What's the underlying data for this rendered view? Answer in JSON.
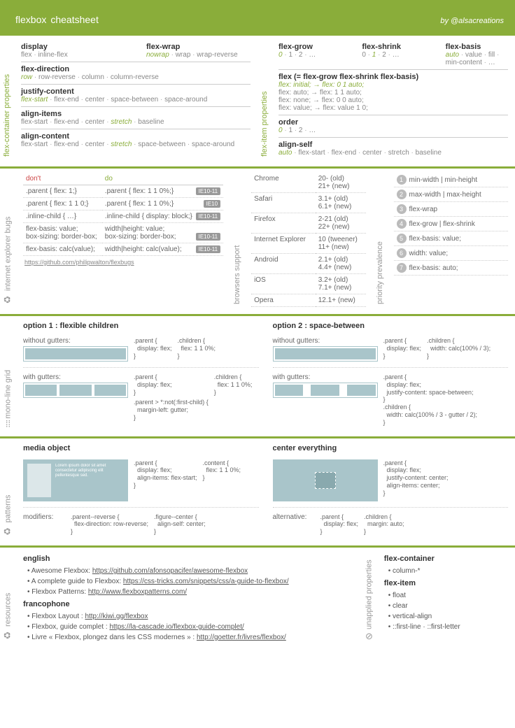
{
  "header": {
    "title": "flexbox",
    "subtitle": "cheatsheet",
    "credit": "by @alsacreations"
  },
  "container_props": [
    {
      "row": [
        {
          "name": "display",
          "vals": [
            [
              "",
              "flex"
            ],
            [
              "sep",
              " · "
            ],
            [
              "",
              "inline-flex"
            ]
          ]
        },
        {
          "name": "flex-wrap",
          "vals": [
            [
              "def",
              "nowrap"
            ],
            [
              "sep",
              " · "
            ],
            [
              "",
              "wrap"
            ],
            [
              "sep",
              " · "
            ],
            [
              "",
              "wrap-reverse"
            ]
          ]
        }
      ]
    },
    {
      "name": "flex-direction",
      "vals": [
        [
          "def",
          "row"
        ],
        [
          "sep",
          " · "
        ],
        [
          "",
          "row-reverse"
        ],
        [
          "sep",
          " · "
        ],
        [
          "",
          "column"
        ],
        [
          "sep",
          " · "
        ],
        [
          "",
          "column-reverse"
        ]
      ]
    },
    {
      "name": "justify-content",
      "vals": [
        [
          "def",
          "flex-start"
        ],
        [
          "sep",
          " · "
        ],
        [
          "",
          "flex-end"
        ],
        [
          "sep",
          " · "
        ],
        [
          "",
          "center"
        ],
        [
          "sep",
          " · "
        ],
        [
          "",
          "space-between"
        ],
        [
          "sep",
          " · "
        ],
        [
          "",
          "space-around"
        ]
      ]
    },
    {
      "name": "align-items",
      "vals": [
        [
          "",
          "flex-start"
        ],
        [
          "sep",
          " · "
        ],
        [
          "",
          "flex-end"
        ],
        [
          "sep",
          " · "
        ],
        [
          "",
          "center"
        ],
        [
          "sep",
          " · "
        ],
        [
          "def",
          "stretch"
        ],
        [
          "sep",
          " · "
        ],
        [
          "",
          "baseline"
        ]
      ]
    },
    {
      "name": "align-content",
      "vals": [
        [
          "",
          "flex-start"
        ],
        [
          "sep",
          " · "
        ],
        [
          "",
          "flex-end"
        ],
        [
          "sep",
          " · "
        ],
        [
          "",
          "center"
        ],
        [
          "sep",
          " · "
        ],
        [
          "def",
          "stretch"
        ],
        [
          "sep",
          " · "
        ],
        [
          "",
          "space-between"
        ],
        [
          "sep",
          " · "
        ],
        [
          "",
          "space-around"
        ]
      ]
    }
  ],
  "item_props": [
    {
      "row": [
        {
          "name": "flex-grow",
          "vals": [
            [
              "def",
              "0"
            ],
            [
              "sep",
              " · "
            ],
            [
              "",
              "1"
            ],
            [
              "sep",
              " · "
            ],
            [
              "",
              "2"
            ],
            [
              "sep",
              " · "
            ],
            [
              "",
              "…"
            ]
          ]
        },
        {
          "name": "flex-shrink",
          "vals": [
            [
              "",
              "0"
            ],
            [
              "sep",
              " · "
            ],
            [
              "def",
              "1"
            ],
            [
              "sep",
              " · "
            ],
            [
              "",
              "2"
            ],
            [
              "sep",
              " · "
            ],
            [
              "",
              "…"
            ]
          ]
        },
        {
          "name": "flex-basis",
          "vals": [
            [
              "def",
              "auto"
            ],
            [
              "sep",
              " · "
            ],
            [
              "",
              "value"
            ],
            [
              "sep",
              " · "
            ],
            [
              "",
              "fill"
            ],
            [
              "sep",
              " · "
            ],
            [
              "",
              "min-content"
            ],
            [
              "sep",
              " · "
            ],
            [
              "",
              "…"
            ]
          ]
        }
      ]
    },
    {
      "name": "flex (= flex-grow flex-shrink flex-basis)",
      "lines": [
        "flex: initial; → flex: 0 1 auto;",
        "flex: auto; → flex: 1 1 auto;",
        "flex: none; → flex: 0 0 auto;",
        "flex: value; → flex: value 1 0;"
      ],
      "firstdef": true
    },
    {
      "name": "order",
      "vals": [
        [
          "def",
          "0"
        ],
        [
          "sep",
          " · "
        ],
        [
          "",
          "1"
        ],
        [
          "sep",
          " · "
        ],
        [
          "",
          "2"
        ],
        [
          "sep",
          " · "
        ],
        [
          "",
          "…"
        ]
      ]
    },
    {
      "name": "align-self",
      "vals": [
        [
          "def",
          "auto"
        ],
        [
          "sep",
          " · "
        ],
        [
          "",
          "flex-start"
        ],
        [
          "sep",
          " · "
        ],
        [
          "",
          "flex-end"
        ],
        [
          "sep",
          " · "
        ],
        [
          "",
          "center"
        ],
        [
          "sep",
          " · "
        ],
        [
          "",
          "stretch"
        ],
        [
          "sep",
          " · "
        ],
        [
          "",
          "baseline"
        ]
      ]
    }
  ],
  "bugs": {
    "headers": [
      "don't",
      "do",
      ""
    ],
    "rows": [
      [
        ".parent { flex: 1;}",
        ".parent { flex: 1 1 0%;}",
        "IE10-11"
      ],
      [
        ".parent { flex: 1 1 0;}",
        ".parent { flex: 1 1 0%;}",
        "IE10"
      ],
      [
        ".inline-child { …}",
        ".inline-child { display: block;}",
        "IE10-11"
      ],
      [
        "flex-basis: value;\nbox-sizing: border-box;",
        "width|height: value;\nbox-sizing: border-box;",
        "IE10-11"
      ],
      [
        "flex-basis:  calc(value);",
        "width|height:  calc(value);",
        "IE10-11"
      ]
    ],
    "link": "https://github.com/philipwalton/flexbugs"
  },
  "browsers": {
    "rows": [
      [
        "Chrome",
        "20- (old)\n21+ (new)"
      ],
      [
        "Safari",
        "3.1+ (old)\n6.1+ (new)"
      ],
      [
        "Firefox",
        "2-21 (old)\n22+ (new)"
      ],
      [
        "Internet Explorer",
        "10 (tweener)\n11+ (new)"
      ],
      [
        "Android",
        "2.1+ (old)\n4.4+ (new)"
      ],
      [
        "iOS",
        "3.2+ (old)\n7.1+ (new)"
      ],
      [
        "Opera",
        "12.1+ (new)"
      ]
    ]
  },
  "priority": [
    "min-width | min-height",
    "max-width | max-height",
    "flex-wrap",
    "flex-grow | flex-shrink",
    "flex-basis: value;",
    "width: value;",
    "flex-basis: auto;"
  ],
  "grid": {
    "opt1": {
      "title": "option 1 : flexible children",
      "without_label": "without gutters:",
      "without_code": [
        ".parent {\n  display: flex;\n}",
        ".children {\n  flex: 1 1 0%;\n}"
      ],
      "with_label": "with gutters:",
      "with_code": [
        ".parent {\n  display: flex;\n}",
        ".children {\n  flex: 1 1 0%;\n}",
        ".parent > *:not(:first-child) {\n  margin-left: gutter;\n}"
      ]
    },
    "opt2": {
      "title": "option 2 : space-between",
      "without_label": "without gutters:",
      "without_code": [
        ".parent {\n  display: flex;\n}",
        ".children {\n  width: calc(100% / 3);\n}"
      ],
      "with_label": "with gutters:",
      "with_code": [
        ".parent {\n  display: flex;\n  justify-content: space-between;\n}\n.children {\n  width: calc(100% / 3 - gutter / 2);\n}"
      ]
    }
  },
  "patterns": {
    "media": {
      "title": "media object",
      "code": [
        ".parent {\n  display: flex;\n  align-items: flex-start;\n}",
        ".content {\n  flex: 1 1 0%;\n}"
      ],
      "mod_label": "modifiers:",
      "mod_code": [
        ".parent--reverse {\n  flex-direction: row-reverse;\n}",
        ".figure--center {\n  align-self: center;\n}"
      ]
    },
    "center": {
      "title": "center everything",
      "code": [
        ".parent {\n  display: flex;\n  justify-content: center;\n  align-items: center;\n}"
      ],
      "alt_label": "alternative:",
      "alt_code": [
        ".parent {\n  display: flex;\n}",
        ".children {\n  margin: auto;\n}"
      ]
    }
  },
  "resources": {
    "english": {
      "title": "english",
      "items": [
        {
          "pre": "Awesome Flexbox: ",
          "url": "https://github.com/afonsopacifer/awesome-flexbox"
        },
        {
          "pre": "A complete guide to Flexbox: ",
          "url": "https://css-tricks.com/snippets/css/a-guide-to-flexbox/"
        },
        {
          "pre": "Flexbox Patterns: ",
          "url": "http://www.flexboxpatterns.com/"
        }
      ]
    },
    "francophone": {
      "title": "francophone",
      "items": [
        {
          "pre": "Flexbox Layout : ",
          "url": "http://kiwi.gg/flexbox"
        },
        {
          "pre": "Flexbox, guide complet : ",
          "url": "https://la-cascade.io/flexbox-guide-complet/"
        },
        {
          "pre": "Livre « Flexbox, plongez dans les CSS modernes » : ",
          "url": "http://goetter.fr/livres/flexbox/"
        }
      ]
    }
  },
  "unapplied": {
    "container": {
      "title": "flex-container",
      "items": [
        "column-*"
      ]
    },
    "item": {
      "title": "flex-item",
      "items": [
        "float",
        "clear",
        "vertical-align",
        "::first-line · ::first-letter"
      ]
    }
  },
  "vlabels": {
    "container": "flex-container properties",
    "item": "flex-item properties",
    "bugs": "internet explorer bugs",
    "browsers": "browsers support",
    "priority": "priority prevalence",
    "grid": "mono-line grid",
    "patterns": "patterns",
    "resources": "resources",
    "unapplied": "unapplied properties"
  }
}
